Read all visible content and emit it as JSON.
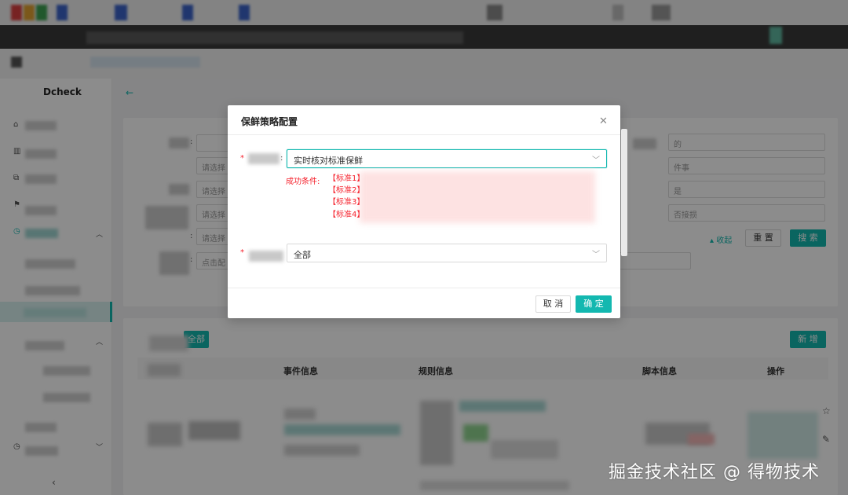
{
  "app": {
    "brand": "Dcheck"
  },
  "filters": {
    "placeholder_1": "请选择",
    "placeholder_2": "请选择",
    "placeholder_3": "请选择",
    "placeholder_4": "请选择",
    "placeholder_5": "点击配",
    "right_value_1": "的",
    "right_value_2": "件事",
    "right_value_3": "是",
    "right_value_4": "否接损",
    "collapse_label": "收起",
    "reset_label": "重 置",
    "search_label": "搜 索"
  },
  "table": {
    "batch_label": "全部",
    "add_label": "新 增",
    "headers": [
      "事件信息",
      "规则信息",
      "脚本信息",
      "操作"
    ]
  },
  "modal": {
    "title": "保鲜策略配置",
    "close_icon": "close-icon",
    "field1": {
      "value": "实时核对标准保鲜"
    },
    "conditions": {
      "title": "成功条件:",
      "items": [
        "【标准1】",
        "【标准2】",
        "【标准3】",
        "【标准4】"
      ]
    },
    "field2": {
      "value": "全部"
    },
    "cancel_label": "取 消",
    "confirm_label": "确 定"
  },
  "watermark": "掘金技术社区 @ 得物技术",
  "colors": {
    "accent": "#13b8b0",
    "danger": "#f5222d"
  }
}
